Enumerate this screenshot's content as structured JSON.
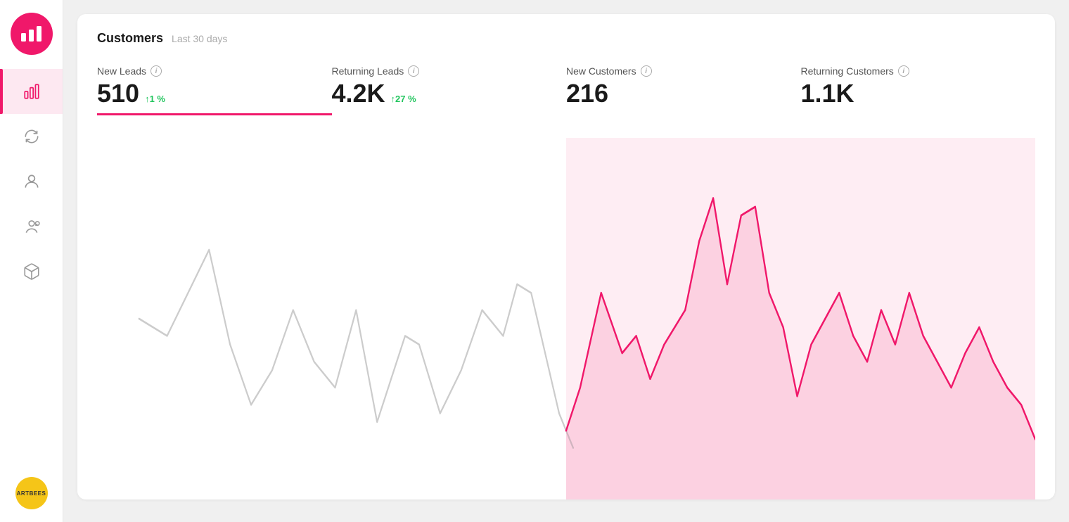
{
  "app": {
    "logo_alt": "Analytics App Logo"
  },
  "sidebar": {
    "items": [
      {
        "id": "analytics",
        "label": "Analytics",
        "active": true
      },
      {
        "id": "sync",
        "label": "Sync",
        "active": false
      },
      {
        "id": "contacts",
        "label": "Contacts",
        "active": false
      },
      {
        "id": "profile",
        "label": "Profile",
        "active": false
      },
      {
        "id": "packages",
        "label": "Packages",
        "active": false
      }
    ],
    "avatar_text": "Artbees"
  },
  "card": {
    "title": "Customers",
    "subtitle": "Last 30 days",
    "metrics": [
      {
        "id": "new-leads",
        "label": "New Leads",
        "value": "510",
        "change": "↑1 %",
        "has_change": true,
        "active": true
      },
      {
        "id": "returning-leads",
        "label": "Returning Leads",
        "value": "4.2K",
        "change": "↑27 %",
        "has_change": true,
        "active": false
      },
      {
        "id": "new-customers",
        "label": "New Customers",
        "value": "216",
        "change": "",
        "has_change": false,
        "active": false
      },
      {
        "id": "returning-customers",
        "label": "Returning Customers",
        "value": "1.1K",
        "change": "",
        "has_change": false,
        "active": false
      }
    ]
  },
  "chart": {
    "accent_color": "#f0186a",
    "fill_color": "rgba(240,24,106,0.12)",
    "line_color": "#ccc"
  },
  "icons": {
    "info": "i",
    "arrow_up": "↑"
  }
}
